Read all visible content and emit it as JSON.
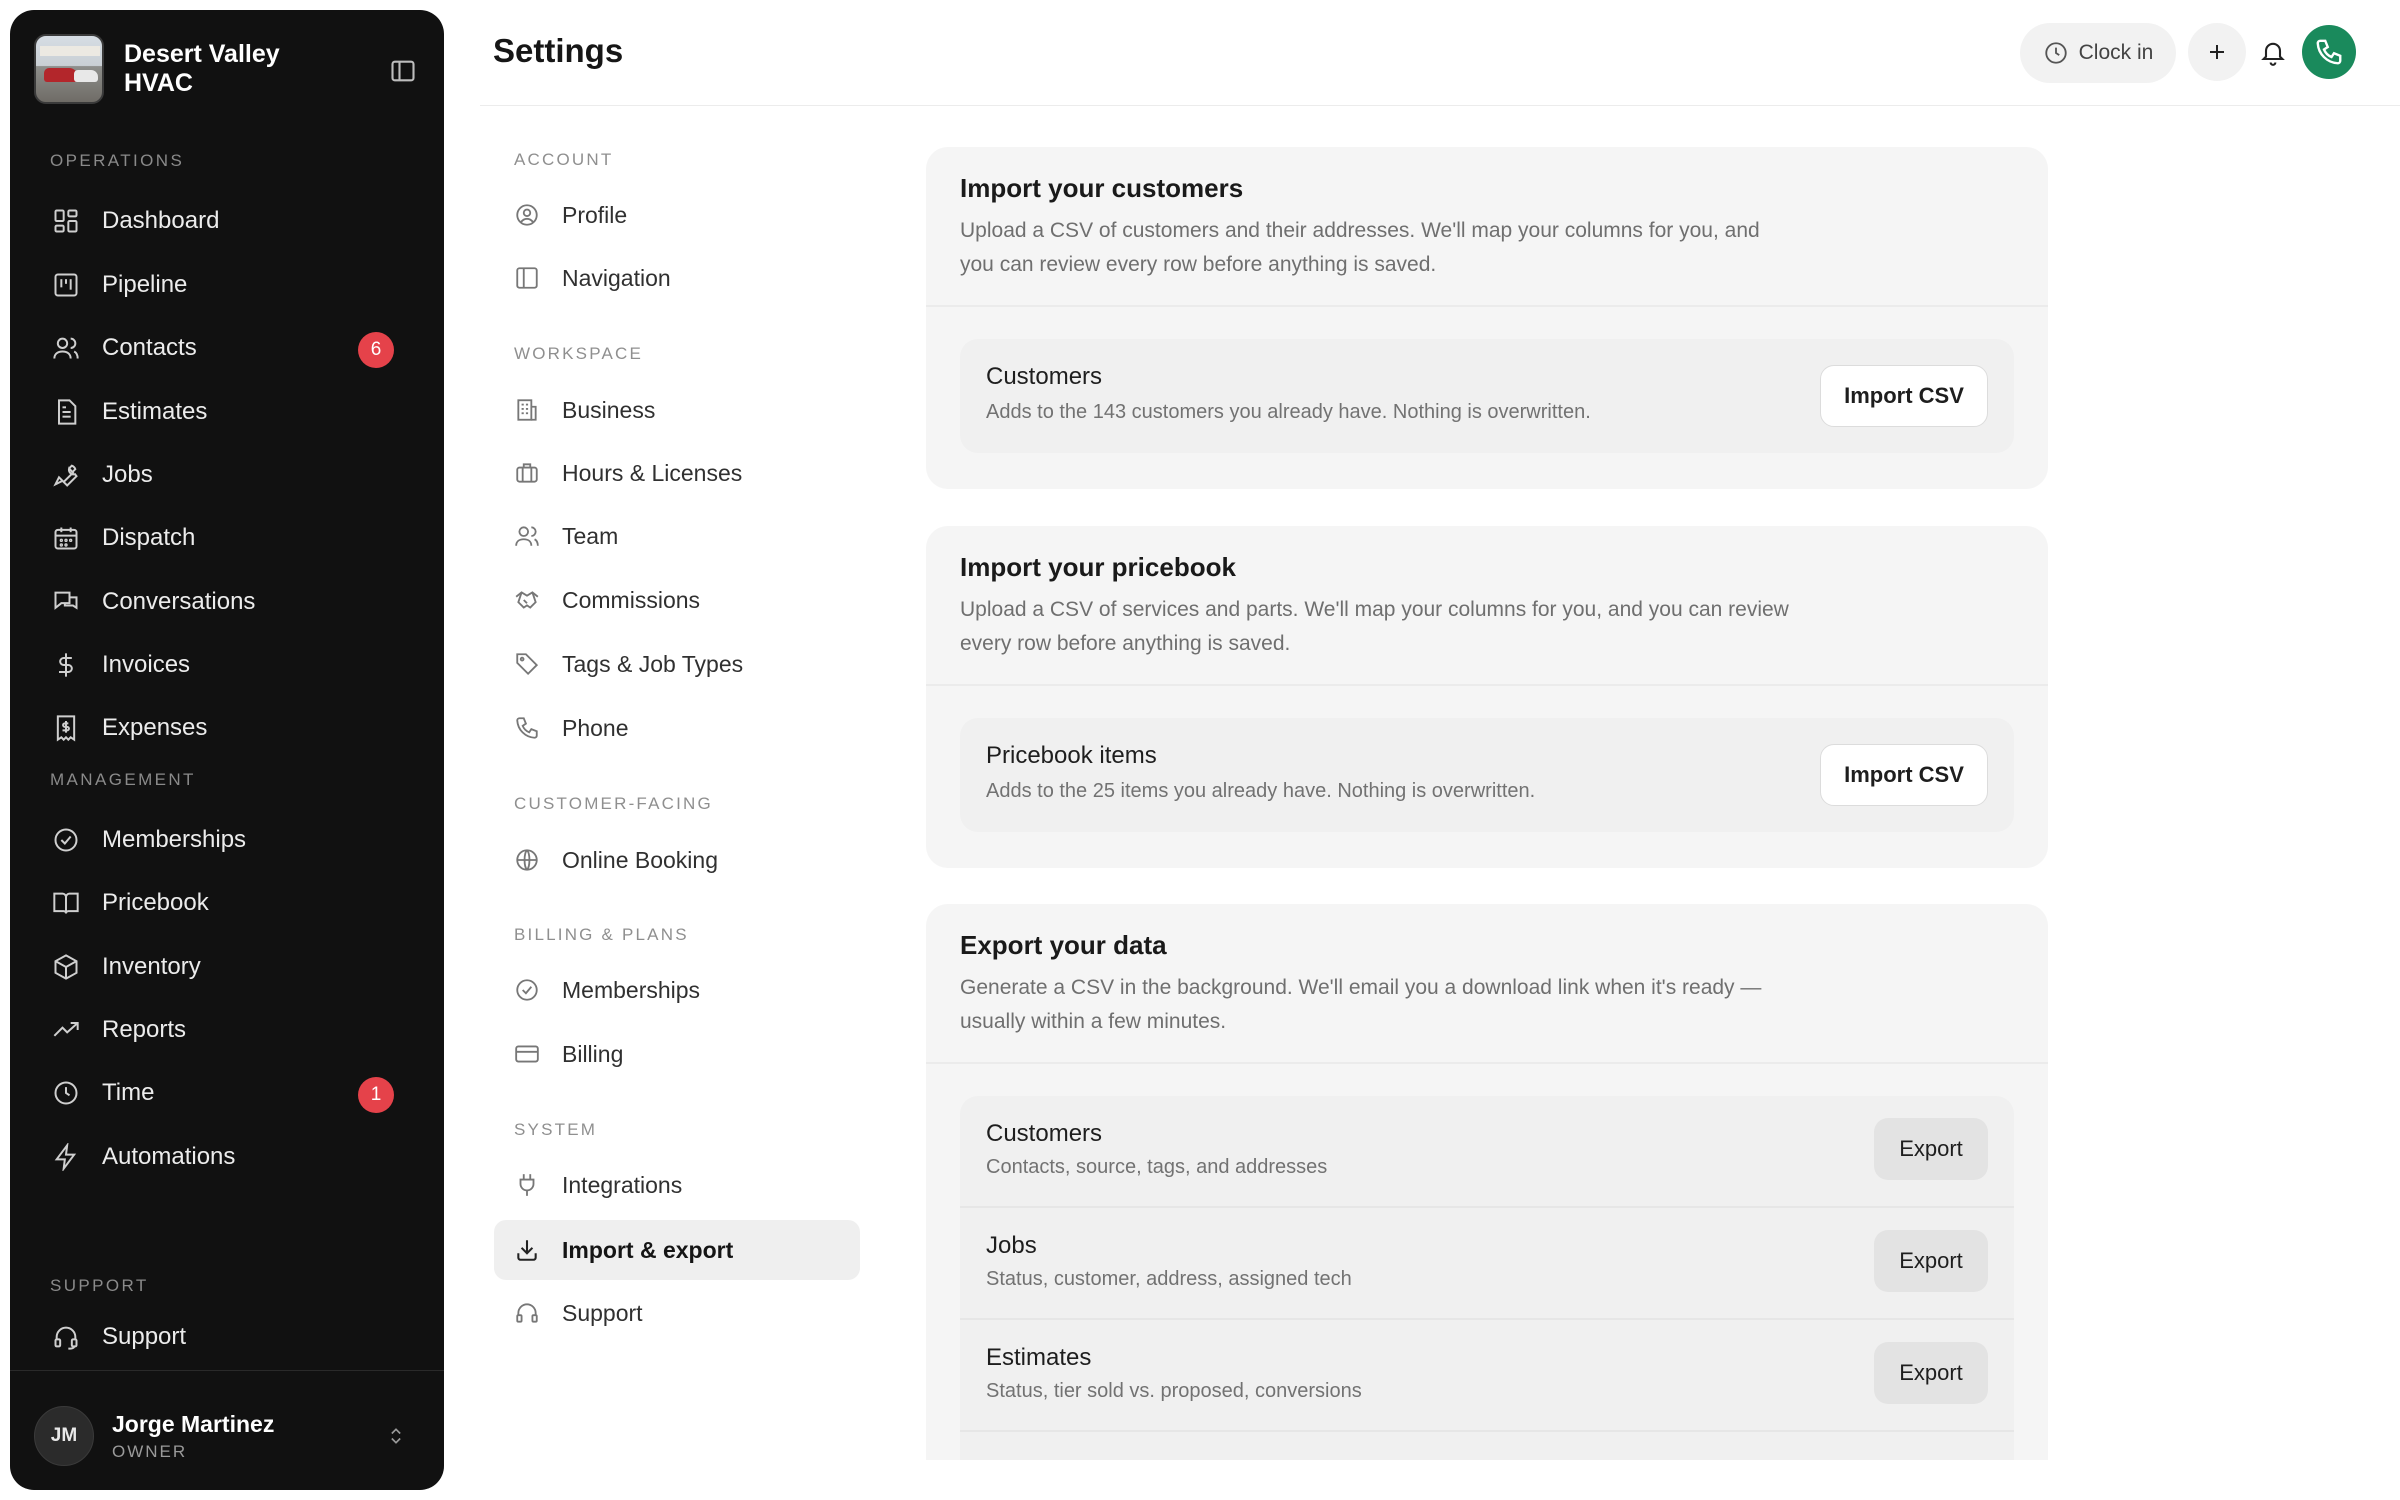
{
  "app": {
    "business_name": "Desert Valley HVAC"
  },
  "sidebar": {
    "sections": {
      "operations": "OPERATIONS",
      "management": "MANAGEMENT",
      "support": "SUPPORT"
    },
    "operations_items": [
      {
        "label": "Dashboard",
        "icon": "dashboard-icon"
      },
      {
        "label": "Pipeline",
        "icon": "pipeline-icon"
      },
      {
        "label": "Contacts",
        "icon": "contacts-icon",
        "badge": "6"
      },
      {
        "label": "Estimates",
        "icon": "estimates-icon"
      },
      {
        "label": "Jobs",
        "icon": "wrench-icon"
      },
      {
        "label": "Dispatch",
        "icon": "calendar-icon"
      },
      {
        "label": "Conversations",
        "icon": "chat-icon"
      },
      {
        "label": "Invoices",
        "icon": "dollar-icon"
      },
      {
        "label": "Expenses",
        "icon": "receipt-icon"
      }
    ],
    "management_items": [
      {
        "label": "Memberships",
        "icon": "badge-check-icon"
      },
      {
        "label": "Pricebook",
        "icon": "book-icon"
      },
      {
        "label": "Inventory",
        "icon": "box-icon"
      },
      {
        "label": "Reports",
        "icon": "trend-icon"
      },
      {
        "label": "Time",
        "icon": "clock-icon",
        "badge": "1"
      },
      {
        "label": "Automations",
        "icon": "bolt-icon"
      }
    ],
    "support_items": [
      {
        "label": "Support",
        "icon": "headset-icon"
      }
    ],
    "user": {
      "initials": "JM",
      "name": "Jorge Martinez",
      "role": "OWNER"
    }
  },
  "header": {
    "title": "Settings",
    "clock_in_label": "Clock in"
  },
  "settings_nav": {
    "sections": {
      "account": "ACCOUNT",
      "workspace": "WORKSPACE",
      "customer_facing": "CUSTOMER-FACING",
      "billing": "BILLING & PLANS",
      "system": "SYSTEM"
    },
    "items": {
      "profile": "Profile",
      "navigation": "Navigation",
      "business": "Business",
      "hours": "Hours & Licenses",
      "team": "Team",
      "commissions": "Commissions",
      "tags": "Tags & Job Types",
      "phone": "Phone",
      "online_booking": "Online Booking",
      "memberships": "Memberships",
      "billing": "Billing",
      "integrations": "Integrations",
      "import_export": "Import & export",
      "support": "Support"
    },
    "active": "import_export"
  },
  "import_customers": {
    "title": "Import your customers",
    "description": "Upload a CSV of customers and their addresses. We'll map your columns for you, and you can review every row before anything is saved.",
    "row_title": "Customers",
    "row_sub": "Adds to the 143 customers you already have. Nothing is overwritten.",
    "button": "Import CSV"
  },
  "import_pricebook": {
    "title": "Import your pricebook",
    "description": "Upload a CSV of services and parts. We'll map your columns for you, and you can review every row before anything is saved.",
    "row_title": "Pricebook items",
    "row_sub": "Adds to the 25 items you already have. Nothing is overwritten.",
    "button": "Import CSV"
  },
  "export": {
    "title": "Export your data",
    "description": "Generate a CSV in the background. We'll email you a download link when it's ready — usually within a few minutes.",
    "rows": [
      {
        "title": "Customers",
        "sub": "Contacts, source, tags, and addresses",
        "button": "Export"
      },
      {
        "title": "Jobs",
        "sub": "Status, customer, address, assigned tech",
        "button": "Export"
      },
      {
        "title": "Estimates",
        "sub": "Status, tier sold vs. proposed, conversions",
        "button": "Export"
      }
    ]
  },
  "colors": {
    "sidebar_bg": "#111111",
    "badge_red": "#e5424a",
    "call_green": "#1a8a5c",
    "card_bg": "#f5f5f5"
  }
}
